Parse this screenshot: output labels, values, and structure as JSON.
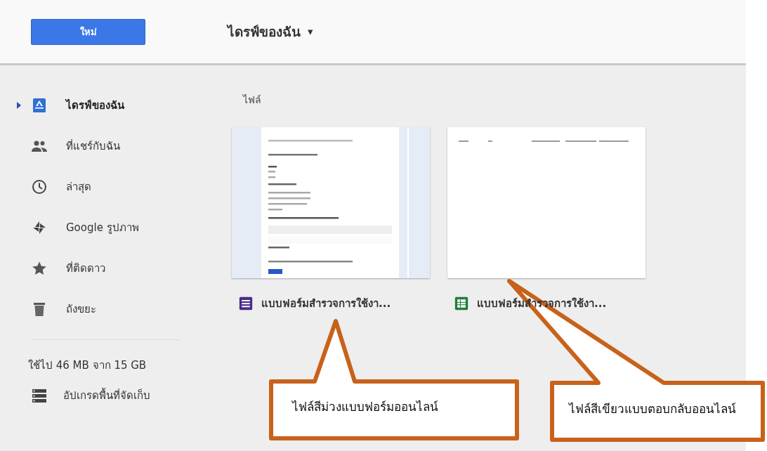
{
  "new_button": {
    "label": "ใหม่"
  },
  "title": {
    "label": "ไดรฟ์ของฉัน",
    "caret": "▾"
  },
  "sidebar": {
    "items": [
      {
        "kind": "drive",
        "label": "ไดรฟ์ของฉัน",
        "selected": true
      },
      {
        "kind": "shared",
        "label": "ที่แชร์กับฉัน",
        "selected": false
      },
      {
        "kind": "recent",
        "label": "ล่าสุด",
        "selected": false
      },
      {
        "kind": "photos",
        "label": "Google รูปภาพ",
        "selected": false
      },
      {
        "kind": "starred",
        "label": "ที่ติดดาว",
        "selected": false
      },
      {
        "kind": "trash",
        "label": "ถังขยะ",
        "selected": false
      }
    ],
    "storage": "ใช้ไป 46 MB จาก 15 GB",
    "upgrade": "อัปเกรดพื้นที่จัดเก็บ"
  },
  "section_label": "ไฟล์",
  "files": [
    {
      "kind": "form",
      "name": "แบบฟอร์มสำรวจการใช้งา..."
    },
    {
      "kind": "sheet",
      "name": "แบบฟอร์มสำรวจการใช้งา..."
    }
  ],
  "callouts": [
    {
      "text": "ไฟล์สีม่วงแบบฟอร์มออนไลน์"
    },
    {
      "text": "ไฟล์สีเขียวแบบตอบกลับออนไลน์"
    }
  ]
}
